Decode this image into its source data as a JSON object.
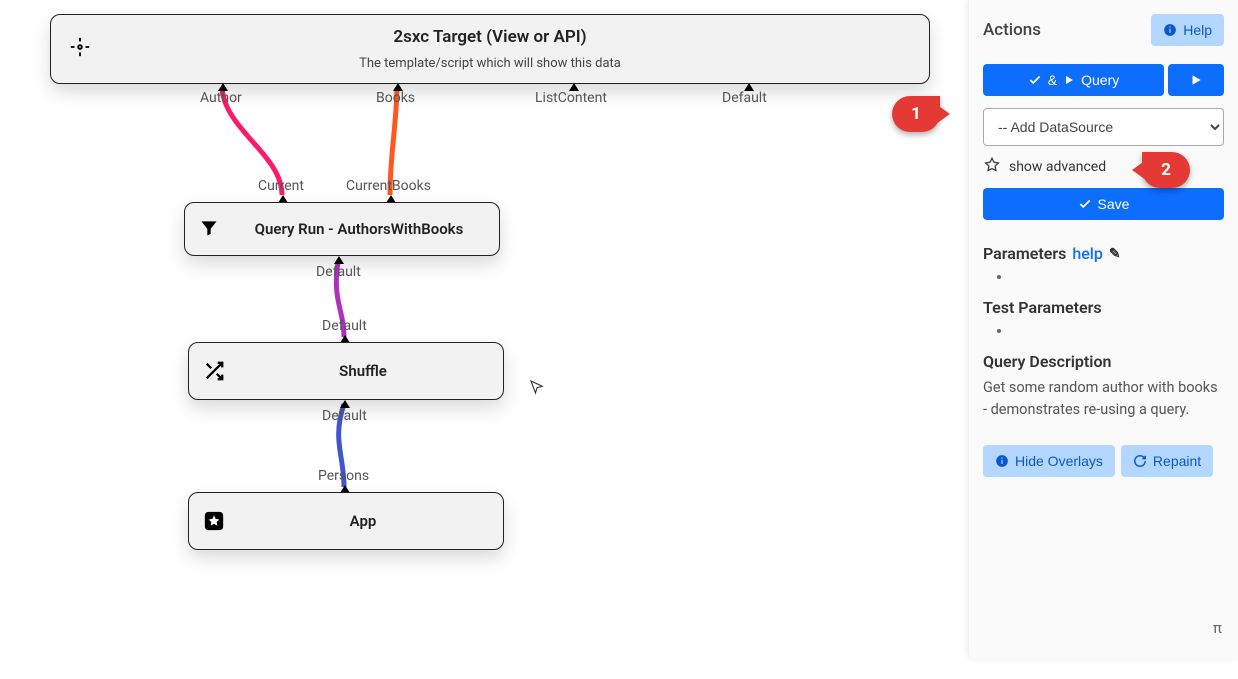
{
  "target": {
    "title": "2sxc Target (View or API)",
    "subtitle": "The template/script which will show this data",
    "inputs": [
      "Author",
      "Books",
      "ListContent",
      "Default"
    ]
  },
  "nodes": {
    "queryRun": {
      "title": "Query Run - AuthorsWithBooks",
      "outTop": [
        "Current",
        "CurrentBooks"
      ],
      "inBottom": "Default"
    },
    "shuffle": {
      "title": "Shuffle",
      "outTop": "Default",
      "inBottom": "Default"
    },
    "app": {
      "title": "App",
      "outTop": "Persons"
    }
  },
  "callouts": {
    "c1": "1",
    "c2": "2"
  },
  "sidebar": {
    "title": "Actions",
    "help": "Help",
    "queryBtn": "&     Query",
    "queryLabelPrefix": "& ",
    "queryWord": "Query",
    "addDataSourcePlaceholder": "-- Add DataSource",
    "showAdvanced": "show advanced",
    "save": "Save",
    "paramsTitle": "Parameters",
    "paramsHelp": "help",
    "testParamsTitle": "Test Parameters",
    "queryDescTitle": "Query Description",
    "queryDesc": "Get some random author with books - demonstrates re-using a query.",
    "hideOverlays": "Hide Overlays",
    "repaint": "Repaint",
    "pi": "π"
  },
  "colors": {
    "primary": "#0d6efd",
    "lightPrimary": "#b3d7ff",
    "callout": "#e53935"
  }
}
